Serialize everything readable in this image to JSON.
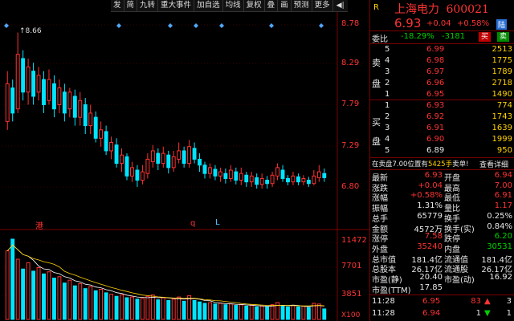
{
  "toolbar": {
    "items": [
      "发",
      "简",
      "九转",
      "重大事件",
      "加自选",
      "均线",
      "复权",
      "叠",
      "画",
      "预测",
      "更多"
    ],
    "arrow": "◀|"
  },
  "chart": {
    "price_ticks": [
      "8.78",
      "8.29",
      "7.79",
      "7.29",
      "6.80"
    ],
    "high_label": "8.66",
    "markers": [
      "港",
      "q",
      "L"
    ],
    "volume_ticks": [
      "11472",
      "7701",
      "3851",
      "X100"
    ]
  },
  "chart_data": {
    "type": "candlestick",
    "price_axis": [
      6.8,
      8.78
    ],
    "volume_axis": [
      0,
      11472
    ],
    "candles": [
      {
        "o": 7.6,
        "c": 8.05,
        "h": 8.2,
        "l": 7.5,
        "up": true
      },
      {
        "o": 8.0,
        "c": 7.7,
        "h": 8.1,
        "l": 7.6,
        "up": false
      },
      {
        "o": 7.75,
        "c": 8.4,
        "h": 8.66,
        "l": 7.7,
        "up": true
      },
      {
        "o": 8.35,
        "c": 7.95,
        "h": 8.45,
        "l": 7.85,
        "up": false
      },
      {
        "o": 7.95,
        "c": 8.25,
        "h": 8.35,
        "l": 7.8,
        "up": true
      },
      {
        "o": 8.2,
        "c": 7.9,
        "h": 8.3,
        "l": 7.8,
        "up": false
      },
      {
        "o": 7.95,
        "c": 8.15,
        "h": 8.25,
        "l": 7.85,
        "up": true
      },
      {
        "o": 8.1,
        "c": 7.8,
        "h": 8.2,
        "l": 7.7,
        "up": false
      },
      {
        "o": 7.85,
        "c": 8.1,
        "h": 8.22,
        "l": 7.8,
        "up": true
      },
      {
        "o": 8.05,
        "c": 7.75,
        "h": 8.15,
        "l": 7.65,
        "up": false
      },
      {
        "o": 7.8,
        "c": 8.0,
        "h": 8.1,
        "l": 7.7,
        "up": true
      },
      {
        "o": 7.95,
        "c": 7.7,
        "h": 8.05,
        "l": 7.6,
        "up": false
      },
      {
        "o": 7.75,
        "c": 7.95,
        "h": 8.0,
        "l": 7.65,
        "up": true
      },
      {
        "o": 7.9,
        "c": 7.65,
        "h": 7.98,
        "l": 7.55,
        "up": false
      },
      {
        "o": 7.65,
        "c": 7.85,
        "h": 7.95,
        "l": 7.55,
        "up": true
      },
      {
        "o": 7.8,
        "c": 7.55,
        "h": 7.88,
        "l": 7.45,
        "up": false
      },
      {
        "o": 7.55,
        "c": 7.7,
        "h": 7.8,
        "l": 7.45,
        "up": true
      },
      {
        "o": 7.65,
        "c": 7.4,
        "h": 7.72,
        "l": 7.35,
        "up": false
      },
      {
        "o": 7.4,
        "c": 7.5,
        "h": 7.6,
        "l": 7.3,
        "up": true
      },
      {
        "o": 7.48,
        "c": 7.25,
        "h": 7.55,
        "l": 7.2,
        "up": false
      },
      {
        "o": 7.25,
        "c": 7.35,
        "h": 7.42,
        "l": 7.15,
        "up": true
      },
      {
        "o": 7.32,
        "c": 7.1,
        "h": 7.4,
        "l": 7.05,
        "up": false
      },
      {
        "o": 7.1,
        "c": 7.2,
        "h": 7.28,
        "l": 7.0,
        "up": true
      },
      {
        "o": 7.18,
        "c": 6.95,
        "h": 7.22,
        "l": 6.9,
        "up": false
      },
      {
        "o": 6.95,
        "c": 7.05,
        "h": 7.12,
        "l": 6.88,
        "up": true
      },
      {
        "o": 7.02,
        "c": 6.9,
        "h": 7.08,
        "l": 6.82,
        "up": false
      },
      {
        "o": 6.9,
        "c": 7.0,
        "h": 7.08,
        "l": 6.85,
        "up": true
      },
      {
        "o": 6.98,
        "c": 7.15,
        "h": 7.22,
        "l": 6.92,
        "up": true
      },
      {
        "o": 7.12,
        "c": 7.25,
        "h": 7.32,
        "l": 7.05,
        "up": true
      },
      {
        "o": 7.22,
        "c": 7.1,
        "h": 7.28,
        "l": 7.02,
        "up": false
      },
      {
        "o": 7.1,
        "c": 7.22,
        "h": 7.3,
        "l": 7.05,
        "up": true
      },
      {
        "o": 7.2,
        "c": 7.05,
        "h": 7.25,
        "l": 6.98,
        "up": false
      },
      {
        "o": 7.05,
        "c": 7.18,
        "h": 7.25,
        "l": 7.0,
        "up": true
      },
      {
        "o": 7.15,
        "c": 7.25,
        "h": 7.35,
        "l": 7.1,
        "up": true
      },
      {
        "o": 7.25,
        "c": 7.1,
        "h": 7.3,
        "l": 7.05,
        "up": false
      },
      {
        "o": 7.1,
        "c": 7.3,
        "h": 7.38,
        "l": 7.05,
        "up": true
      },
      {
        "o": 7.28,
        "c": 7.15,
        "h": 7.35,
        "l": 7.1,
        "up": false
      },
      {
        "o": 7.15,
        "c": 7.08,
        "h": 7.22,
        "l": 7.0,
        "up": false
      },
      {
        "o": 7.08,
        "c": 6.98,
        "h": 7.12,
        "l": 6.92,
        "up": false
      },
      {
        "o": 6.98,
        "c": 7.05,
        "h": 7.1,
        "l": 6.92,
        "up": true
      },
      {
        "o": 7.03,
        "c": 6.95,
        "h": 7.08,
        "l": 6.9,
        "up": false
      },
      {
        "o": 6.95,
        "c": 7.0,
        "h": 7.05,
        "l": 6.88,
        "up": true
      },
      {
        "o": 6.98,
        "c": 6.92,
        "h": 7.04,
        "l": 6.86,
        "up": false
      },
      {
        "o": 6.92,
        "c": 7.02,
        "h": 7.08,
        "l": 6.88,
        "up": true
      },
      {
        "o": 7.0,
        "c": 6.9,
        "h": 7.05,
        "l": 6.85,
        "up": false
      },
      {
        "o": 6.9,
        "c": 6.98,
        "h": 7.05,
        "l": 6.84,
        "up": true
      },
      {
        "o": 6.96,
        "c": 6.88,
        "h": 7.0,
        "l": 6.82,
        "up": false
      },
      {
        "o": 6.88,
        "c": 6.95,
        "h": 7.0,
        "l": 6.82,
        "up": true
      },
      {
        "o": 6.93,
        "c": 6.85,
        "h": 6.98,
        "l": 6.8,
        "up": false
      },
      {
        "o": 6.85,
        "c": 6.92,
        "h": 6.98,
        "l": 6.8,
        "up": true
      },
      {
        "o": 6.9,
        "c": 6.86,
        "h": 6.95,
        "l": 6.8,
        "up": false
      },
      {
        "o": 6.86,
        "c": 6.96,
        "h": 7.0,
        "l": 6.82,
        "up": true
      },
      {
        "o": 6.95,
        "c": 7.05,
        "h": 7.1,
        "l": 6.9,
        "up": true
      },
      {
        "o": 7.02,
        "c": 6.92,
        "h": 7.08,
        "l": 6.88,
        "up": false
      },
      {
        "o": 6.92,
        "c": 6.88,
        "h": 6.96,
        "l": 6.84,
        "up": false
      },
      {
        "o": 6.88,
        "c": 6.95,
        "h": 7.0,
        "l": 6.84,
        "up": true
      },
      {
        "o": 6.94,
        "c": 6.88,
        "h": 6.98,
        "l": 6.84,
        "up": false
      },
      {
        "o": 6.88,
        "c": 6.92,
        "h": 6.96,
        "l": 6.84,
        "up": true
      },
      {
        "o": 6.9,
        "c": 6.86,
        "h": 6.94,
        "l": 6.82,
        "up": false
      },
      {
        "o": 6.86,
        "c": 6.95,
        "h": 7.02,
        "l": 6.84,
        "up": true
      },
      {
        "o": 6.93,
        "c": 7.0,
        "h": 7.08,
        "l": 6.88,
        "up": true
      },
      {
        "o": 6.98,
        "c": 6.93,
        "h": 7.04,
        "l": 6.88,
        "up": false
      }
    ],
    "volumes": [
      9800,
      11472,
      8600,
      7200,
      8100,
      6900,
      7400,
      6500,
      6800,
      5900,
      6100,
      5200,
      5600,
      4800,
      5100,
      4400,
      4700,
      4100,
      4300,
      3800,
      3600,
      3300,
      3500,
      3100,
      3200,
      2900,
      3000,
      3300,
      3500,
      2800,
      3100,
      2700,
      2900,
      3200,
      2600,
      3400,
      2700,
      2500,
      2300,
      2400,
      2200,
      2300,
      2100,
      2200,
      2000,
      2100,
      1900,
      2000,
      1800,
      1900,
      1800,
      2100,
      2400,
      1900,
      1800,
      2000,
      1800,
      1900,
      1700,
      2300,
      2200,
      1500
    ]
  },
  "quote": {
    "code_label": "R",
    "name": "上海电力",
    "code": "600021",
    "price": "6.93",
    "change": "+0.04",
    "change_pct": "+0.58%",
    "tag": "陆",
    "weibi_label": "委比",
    "weibi_val": "-18.29%",
    "weicha_val": "-3181",
    "buy_btn": "买",
    "sell_btn": "卖",
    "sell_side_label": [
      "卖",
      "盘"
    ],
    "buy_side_label": [
      "买",
      "盘"
    ],
    "asks": [
      {
        "lvl": "5",
        "price": "6.99",
        "vol": "2513"
      },
      {
        "lvl": "4",
        "price": "6.98",
        "vol": "1775"
      },
      {
        "lvl": "3",
        "price": "6.97",
        "vol": "1789"
      },
      {
        "lvl": "2",
        "price": "6.96",
        "vol": "2718"
      },
      {
        "lvl": "1",
        "price": "6.95",
        "vol": "1490"
      }
    ],
    "bids": [
      {
        "lvl": "1",
        "price": "6.93",
        "vol": "774"
      },
      {
        "lvl": "2",
        "price": "6.92",
        "vol": "1743"
      },
      {
        "lvl": "3",
        "price": "6.91",
        "vol": "1639"
      },
      {
        "lvl": "4",
        "price": "6.90",
        "vol": "1999"
      },
      {
        "lvl": "5",
        "price": "6.89",
        "vol": "950"
      }
    ],
    "notice": "在卖盘7.00位置有",
    "notice_vol": "5425手",
    "notice_tail": "卖单!",
    "notice_link": "查看详细",
    "stats": [
      {
        "l1": "最新",
        "v1": "6.93",
        "c1": "red",
        "l2": "开盘",
        "v2": "6.94",
        "c2": "red"
      },
      {
        "l1": "涨跌",
        "v1": "+0.04",
        "c1": "red",
        "l2": "最高",
        "v2": "7.00",
        "c2": "red"
      },
      {
        "l1": "涨幅",
        "v1": "+0.58%",
        "c1": "red",
        "l2": "最低",
        "v2": "6.91",
        "c2": "red"
      },
      {
        "l1": "振幅",
        "v1": "1.31%",
        "c1": "white",
        "l2": "量比",
        "v2": "1.17",
        "c2": "red"
      },
      {
        "l1": "总手",
        "v1": "65779",
        "c1": "white",
        "l2": "换手",
        "v2": "0.25%",
        "c2": "white"
      },
      {
        "l1": "金额",
        "v1": "4572万",
        "c1": "white",
        "l2": "换手(实)",
        "v2": "0.84%",
        "c2": "white"
      },
      {
        "l1": "涨停",
        "v1": "7.58",
        "c1": "red",
        "l2": "跌停",
        "v2": "6.20",
        "c2": "green"
      },
      {
        "l1": "外盘",
        "v1": "35240",
        "c1": "red",
        "l2": "内盘",
        "v2": "30531",
        "c2": "green"
      },
      {
        "l1": "总市值",
        "v1": "181.4亿",
        "c1": "white",
        "l2": "流通值",
        "v2": "181.4亿",
        "c2": "white"
      },
      {
        "l1": "总股本",
        "v1": "26.17亿",
        "c1": "white",
        "l2": "流通股",
        "v2": "26.17亿",
        "c2": "white"
      },
      {
        "l1": "市盈(静)",
        "v1": "20.40",
        "c1": "white",
        "l2": "市盈(动)",
        "v2": "16.92",
        "c2": "white"
      },
      {
        "l1": "市盈(TTM)",
        "v1": "17.85",
        "c1": "white",
        "l2": "",
        "v2": "",
        "c2": "white"
      }
    ],
    "ticks": [
      {
        "time": "11:28",
        "price": "6.95",
        "vol": "83",
        "dir": "up",
        "n": "3"
      },
      {
        "time": "11:28",
        "price": "6.94",
        "vol": "1",
        "dir": "down",
        "n": "1"
      }
    ]
  },
  "colors": {
    "up": "#ff3333",
    "down": "#00e5ff",
    "grid": "#7a0000",
    "ma1": "#ffffff",
    "ma2": "#ffd200",
    "ma3": "#ff00ff"
  }
}
